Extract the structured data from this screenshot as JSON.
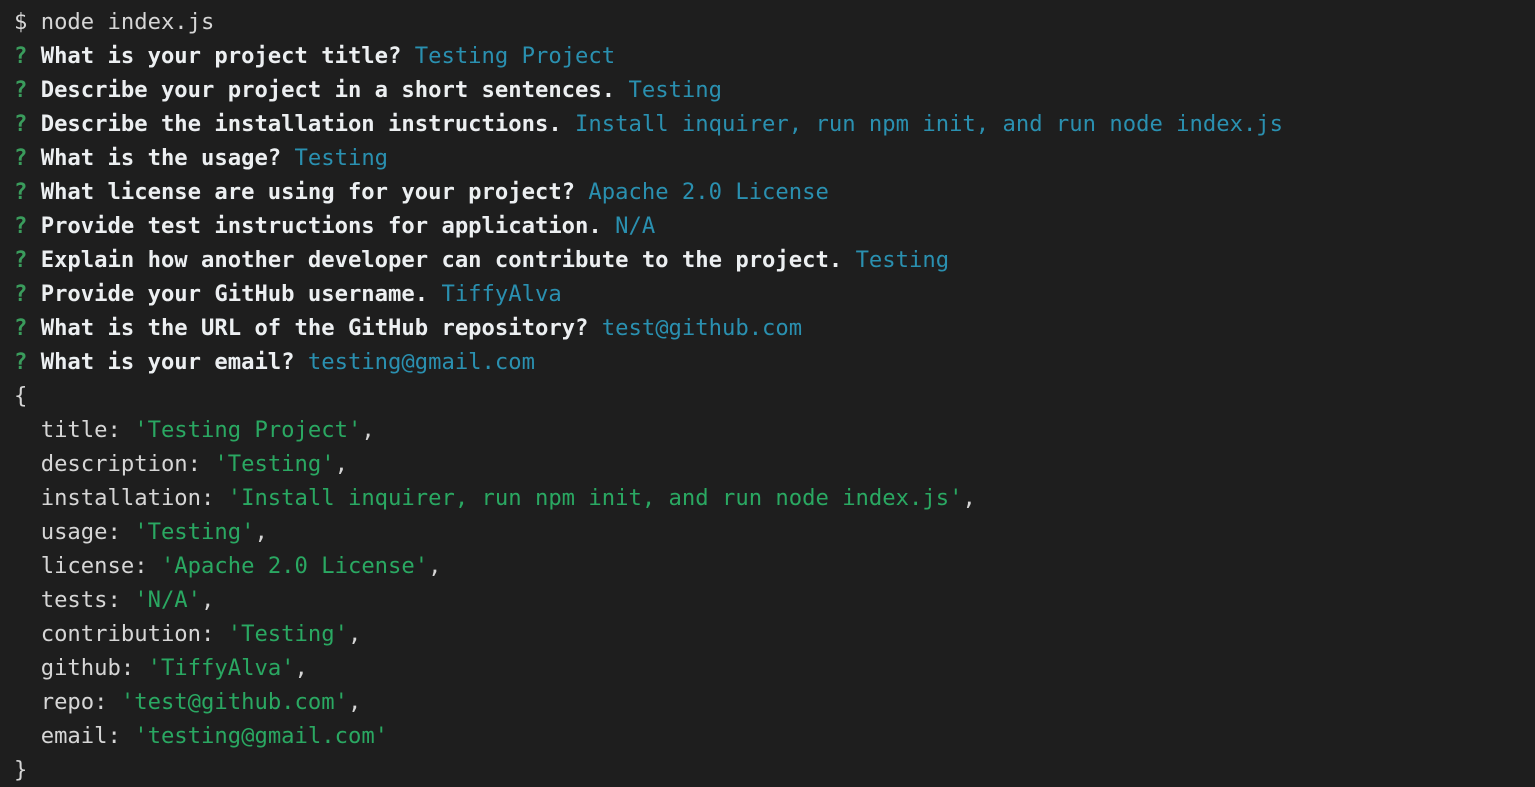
{
  "terminal": {
    "background_color": "#1e1e1e",
    "prompt_symbol": "$",
    "question_symbol": "?",
    "colors": {
      "command": "#d6d6d6",
      "question_marker": "#3a9c5c",
      "question": "#eceff1",
      "answer": "#2a90b0",
      "object_key": "#d6d6d6",
      "object_string": "#2aa862"
    },
    "command_line": {
      "sigil": "$",
      "command": " node index.js"
    },
    "prompts": [
      {
        "sigil": "?",
        "question": " What is your project title? ",
        "answer": "Testing Project"
      },
      {
        "sigil": "?",
        "question": " Describe your project in a short sentences. ",
        "answer": "Testing"
      },
      {
        "sigil": "?",
        "question": " Describe the installation instructions. ",
        "answer": "Install inquirer, run npm init, and run node index.js"
      },
      {
        "sigil": "?",
        "question": " What is the usage? ",
        "answer": "Testing"
      },
      {
        "sigil": "?",
        "question": " What license are using for your project? ",
        "answer": "Apache 2.0 License"
      },
      {
        "sigil": "?",
        "question": " Provide test instructions for application. ",
        "answer": "N/A"
      },
      {
        "sigil": "?",
        "question": " Explain how another developer can contribute to the project. ",
        "answer": "Testing"
      },
      {
        "sigil": "?",
        "question": " Provide your GitHub username. ",
        "answer": "TiffyAlva"
      },
      {
        "sigil": "?",
        "question": " What is the URL of the GitHub repository? ",
        "answer": "test@github.com"
      },
      {
        "sigil": "?",
        "question": " What is your email? ",
        "answer": "testing@gmail.com"
      }
    ],
    "object_output": {
      "open_brace": "{",
      "close_brace": "}",
      "indent": "  ",
      "entries": [
        {
          "key": "title",
          "sep": ": ",
          "value": "'Testing Project'",
          "comma": ","
        },
        {
          "key": "description",
          "sep": ": ",
          "value": "'Testing'",
          "comma": ","
        },
        {
          "key": "installation",
          "sep": ": ",
          "value": "'Install inquirer, run npm init, and run node index.js'",
          "comma": ","
        },
        {
          "key": "usage",
          "sep": ": ",
          "value": "'Testing'",
          "comma": ","
        },
        {
          "key": "license",
          "sep": ": ",
          "value": "'Apache 2.0 License'",
          "comma": ","
        },
        {
          "key": "tests",
          "sep": ": ",
          "value": "'N/A'",
          "comma": ","
        },
        {
          "key": "contribution",
          "sep": ": ",
          "value": "'Testing'",
          "comma": ","
        },
        {
          "key": "github",
          "sep": ": ",
          "value": "'TiffyAlva'",
          "comma": ","
        },
        {
          "key": "repo",
          "sep": ": ",
          "value": "'test@github.com'",
          "comma": ","
        },
        {
          "key": "email",
          "sep": ": ",
          "value": "'testing@gmail.com'",
          "comma": ""
        }
      ]
    }
  }
}
